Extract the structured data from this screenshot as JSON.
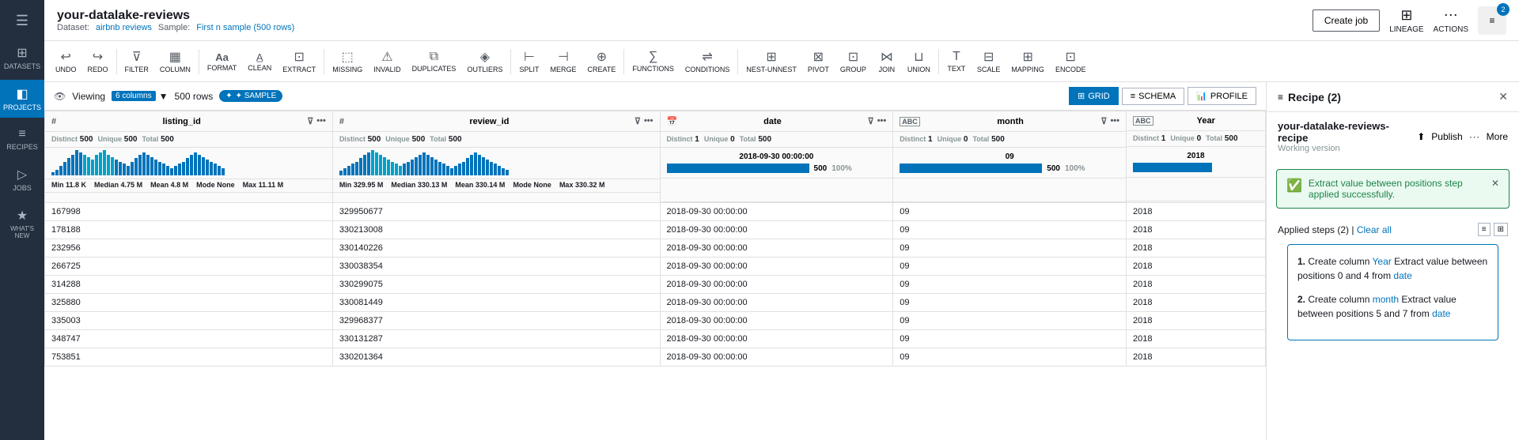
{
  "app": {
    "title": "your-datalake-reviews",
    "dataset_label": "Dataset:",
    "dataset_link": "airbnb reviews",
    "sample_label": "Sample:",
    "sample_link": "First n sample (500 rows)"
  },
  "sidebar": {
    "hamburger": "☰",
    "items": [
      {
        "id": "datasets",
        "label": "DATASETS",
        "icon": "⊞"
      },
      {
        "id": "projects",
        "label": "PROJECTS",
        "icon": "◧",
        "active": true
      },
      {
        "id": "recipes",
        "label": "RECIPES",
        "icon": "≡"
      },
      {
        "id": "jobs",
        "label": "JOBS",
        "icon": "▷"
      },
      {
        "id": "whats-new",
        "label": "WHAT'S NEW",
        "icon": "★"
      }
    ]
  },
  "toolbar": {
    "buttons": [
      {
        "id": "undo",
        "icon": "↩",
        "label": "UNDO"
      },
      {
        "id": "redo",
        "icon": "↪",
        "label": "REDO"
      },
      {
        "id": "filter",
        "icon": "⊽",
        "label": "FILTER"
      },
      {
        "id": "column",
        "icon": "▦",
        "label": "COLUMN"
      },
      {
        "id": "format",
        "icon": "Aa",
        "label": "FORMAT"
      },
      {
        "id": "clean",
        "icon": "A̲",
        "label": "CLEAN"
      },
      {
        "id": "extract",
        "icon": "⊡",
        "label": "EXTRACT"
      },
      {
        "id": "missing",
        "icon": "⬚",
        "label": "MISSING"
      },
      {
        "id": "invalid",
        "icon": "⚠",
        "label": "INVALID"
      },
      {
        "id": "duplicates",
        "icon": "⧉",
        "label": "DUPLICATES"
      },
      {
        "id": "outliers",
        "icon": "◈",
        "label": "OUTLIERS"
      },
      {
        "id": "split",
        "icon": "⊢",
        "label": "SPLIT"
      },
      {
        "id": "merge",
        "icon": "⊣",
        "label": "MERGE"
      },
      {
        "id": "create",
        "icon": "⊕",
        "label": "CREATE"
      },
      {
        "id": "functions",
        "icon": "∑",
        "label": "FUNCTIONS"
      },
      {
        "id": "conditions",
        "icon": "⇌",
        "label": "CONDITIONS"
      },
      {
        "id": "nest-unnest",
        "icon": "⊞",
        "label": "NEST-UNNEST"
      },
      {
        "id": "pivot",
        "icon": "⊠",
        "label": "PIVOT"
      },
      {
        "id": "group",
        "icon": "⊡",
        "label": "GROUP"
      },
      {
        "id": "join",
        "icon": "⋈",
        "label": "JOIN"
      },
      {
        "id": "union",
        "icon": "⊔",
        "label": "UNION"
      },
      {
        "id": "text",
        "icon": "T",
        "label": "TEXT"
      },
      {
        "id": "scale",
        "icon": "⊟",
        "label": "SCALE"
      },
      {
        "id": "mapping",
        "icon": "⊞",
        "label": "MAPPING"
      },
      {
        "id": "encode",
        "icon": "⊡",
        "label": "ENCODE"
      }
    ],
    "create_job": "Create job",
    "lineage": "LINEAGE",
    "actions": "ACTIONS"
  },
  "view_controls": {
    "viewing_label": "Viewing",
    "columns_count": "6 columns",
    "rows_label": "500 rows",
    "sample_badge": "✦ SAMPLE",
    "grid_label": "GRID",
    "schema_label": "SCHEMA",
    "profile_label": "PROFILE"
  },
  "columns": [
    {
      "id": "listing_id",
      "type": "#",
      "name": "listing_id",
      "stats": {
        "distinct": "500",
        "unique": "500",
        "total": "500"
      },
      "histogram_bars": [
        3,
        5,
        8,
        12,
        15,
        18,
        22,
        20,
        18,
        16,
        14,
        18,
        20,
        22,
        18,
        16,
        14,
        12,
        10,
        8,
        12,
        15,
        18,
        20,
        18,
        16,
        14,
        12,
        10,
        8,
        6,
        8,
        10,
        12,
        15,
        18,
        20,
        18,
        16,
        14,
        12,
        10,
        8,
        6
      ],
      "min": "11.8 K",
      "median": "4.75 M",
      "mean": "4.8 M",
      "mode": "None",
      "max": "11.11 M"
    },
    {
      "id": "review_id",
      "type": "#",
      "name": "review_id",
      "stats": {
        "distinct": "500",
        "unique": "500",
        "total": "500"
      },
      "histogram_bars": [
        4,
        6,
        8,
        10,
        12,
        15,
        18,
        20,
        22,
        20,
        18,
        16,
        14,
        12,
        10,
        8,
        10,
        12,
        14,
        16,
        18,
        20,
        18,
        16,
        14,
        12,
        10,
        8,
        6,
        8,
        10,
        12,
        15,
        18,
        20,
        18,
        16,
        14,
        12,
        10,
        8,
        6,
        5
      ],
      "min": "329.95 M",
      "median": "330.13 M",
      "mean": "330.14 M",
      "mode": "None",
      "max": "330.32 M"
    },
    {
      "id": "date",
      "type": "📅",
      "name": "date",
      "stats": {
        "distinct": "1",
        "unique": "0",
        "total": "500"
      },
      "top_value": "2018-09-30 00:00:00",
      "top_pct": "500",
      "top_bar_pct": 100
    },
    {
      "id": "month",
      "type": "ABC",
      "name": "month",
      "stats": {
        "distinct": "1",
        "unique": "0",
        "total": "500"
      },
      "top_value": "09",
      "top_pct": "500",
      "top_bar_pct": 100
    },
    {
      "id": "year",
      "type": "ABC",
      "name": "Year",
      "stats": {
        "distinct": "1",
        "unique": "0",
        "total": "500"
      },
      "top_value": "2018",
      "top_bar_pct": 100
    }
  ],
  "rows": [
    {
      "listing_id": "167998",
      "review_id": "329950677",
      "date": "2018-09-30 00:00:00",
      "month": "09",
      "year": "2018"
    },
    {
      "listing_id": "178188",
      "review_id": "330213008",
      "date": "2018-09-30 00:00:00",
      "month": "09",
      "year": "2018"
    },
    {
      "listing_id": "232956",
      "review_id": "330140226",
      "date": "2018-09-30 00:00:00",
      "month": "09",
      "year": "2018"
    },
    {
      "listing_id": "266725",
      "review_id": "330038354",
      "date": "2018-09-30 00:00:00",
      "month": "09",
      "year": "2018"
    },
    {
      "listing_id": "314288",
      "review_id": "330299075",
      "date": "2018-09-30 00:00:00",
      "month": "09",
      "year": "2018"
    },
    {
      "listing_id": "325880",
      "review_id": "330081449",
      "date": "2018-09-30 00:00:00",
      "month": "09",
      "year": "2018"
    },
    {
      "listing_id": "335003",
      "review_id": "329968377",
      "date": "2018-09-30 00:00:00",
      "month": "09",
      "year": "2018"
    },
    {
      "listing_id": "348747",
      "review_id": "330131287",
      "date": "2018-09-30 00:00:00",
      "month": "09",
      "year": "2018"
    },
    {
      "listing_id": "753851",
      "review_id": "330201364",
      "date": "2018-09-30 00:00:00",
      "month": "09",
      "year": "2018"
    }
  ],
  "recipe_panel": {
    "title": "Recipe (2)",
    "recipe_name": "your-datalake-reviews-recipe",
    "working_version": "Working version",
    "publish_label": "Publish",
    "more_label": "More",
    "success_message": "Extract value between positions step applied successfully.",
    "applied_steps_label": "Applied steps (2)",
    "separator": "|",
    "clear_all": "Clear all",
    "steps": [
      {
        "num": "1.",
        "text": "Create column",
        "highlight": "Year",
        "rest": "Extract value between positions 0 and 4 from",
        "source": "date"
      },
      {
        "num": "2.",
        "text": "Create column",
        "highlight": "month",
        "rest": "Extract value between positions 5 and 7 from",
        "source": "date"
      }
    ]
  },
  "recipe_badge": "2"
}
